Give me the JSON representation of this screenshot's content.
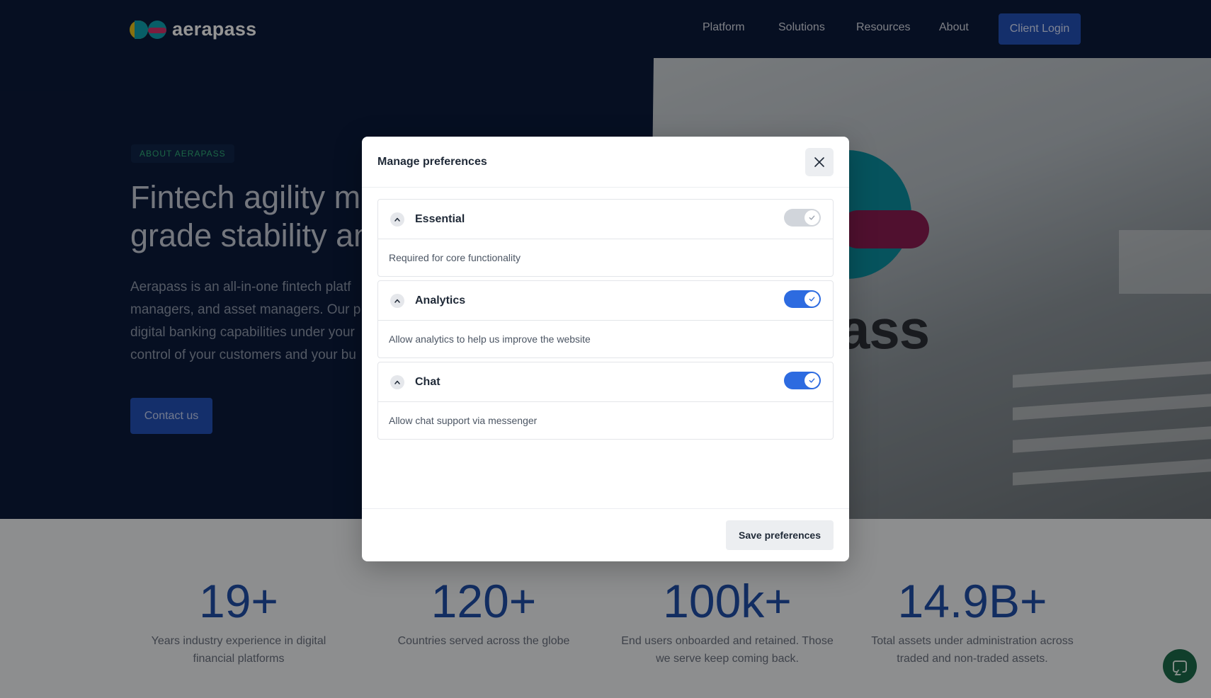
{
  "header": {
    "logo_text": "aerapass",
    "nav": [
      "Platform",
      "Solutions",
      "Resources",
      "About"
    ],
    "login_label": "Client Login"
  },
  "hero": {
    "badge": "ABOUT AERAPASS",
    "title_line1": "Fintech agility me",
    "title_line2": "grade stability an",
    "para_lines": [
      "Aerapass is an all-in-one fintech platf",
      "managers, and asset managers. Our p",
      "digital banking capabilities under your",
      "control of your customers and your bu"
    ],
    "contact_label": "Contact us",
    "photo_text": "ass"
  },
  "stats": [
    {
      "value": "19+",
      "label_lines": [
        "Years industry experience in digital",
        "financial platforms"
      ]
    },
    {
      "value": "120+",
      "label_lines": [
        "Countries served across the globe",
        ""
      ]
    },
    {
      "value": "100k+",
      "label_lines": [
        "End users onboarded and retained. Those",
        "we serve keep coming back."
      ]
    },
    {
      "value": "14.9B+",
      "label_lines": [
        "Total assets under administration across",
        "traded and non-traded assets."
      ]
    }
  ],
  "modal": {
    "title": "Manage preferences",
    "sections": [
      {
        "title": "Essential",
        "description": "Required for core functionality",
        "enabled": true,
        "locked": true
      },
      {
        "title": "Analytics",
        "description": "Allow analytics to help us improve the website",
        "enabled": true,
        "locked": false
      },
      {
        "title": "Chat",
        "description": "Allow chat support via messenger",
        "enabled": true,
        "locked": false
      }
    ],
    "save_label": "Save preferences"
  },
  "colors": {
    "navy": "#0c1a3b",
    "brand_blue": "#2451b8",
    "toggle_on": "#2d6be0",
    "badge_green": "#2fae78",
    "chat_fab": "#1c6b4a"
  },
  "icons": {
    "close": "close-icon",
    "chevron": "chevron-up-icon",
    "check": "check-icon",
    "chat": "chat-bubble-icon"
  }
}
